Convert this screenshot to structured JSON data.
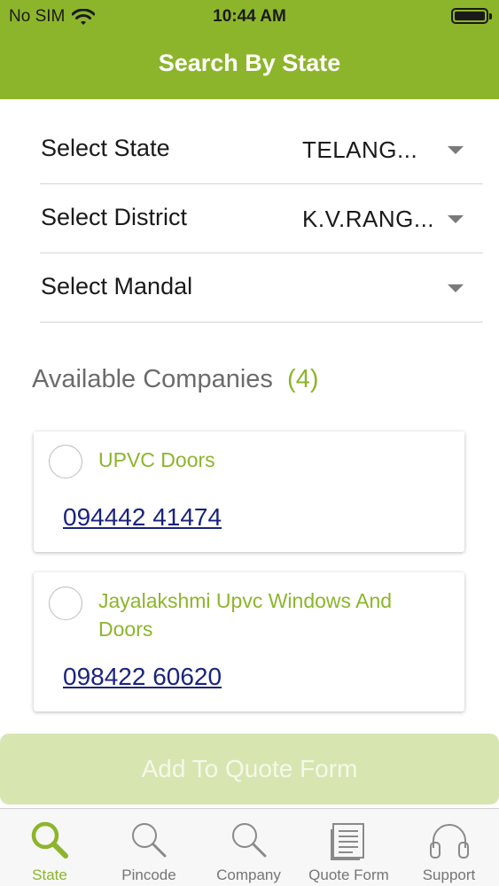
{
  "status_bar": {
    "carrier": "No SIM",
    "time": "10:44 AM",
    "wifi_icon": "wifi-icon",
    "battery_icon": "battery-icon",
    "battery_level": 1.0
  },
  "header": {
    "title": "Search By State"
  },
  "filters": {
    "state": {
      "label": "Select State",
      "value": "TELANG..."
    },
    "district": {
      "label": "Select District",
      "value": "K.V.RANG..."
    },
    "mandal": {
      "label": "Select Mandal",
      "value": ""
    }
  },
  "companies": {
    "title": "Available Companies",
    "count": "(4)",
    "items": [
      {
        "name": "UPVC Doors",
        "phone": "094442 41474",
        "selected": false
      },
      {
        "name": "Jayalakshmi Upvc Windows And Doors",
        "phone": "098422 60620",
        "selected": false
      }
    ]
  },
  "quote_button": {
    "label": "Add To Quote Form"
  },
  "tabs": [
    {
      "label": "State",
      "icon": "search-icon",
      "active": true
    },
    {
      "label": "Pincode",
      "icon": "search-icon",
      "active": false
    },
    {
      "label": "Company",
      "icon": "search-icon",
      "active": false
    },
    {
      "label": "Quote Form",
      "icon": "document-icon",
      "active": false
    },
    {
      "label": "Support",
      "icon": "headphones-icon",
      "active": false
    }
  ],
  "colors": {
    "accent": "#8db52c",
    "link": "#1a237e",
    "button_disabled": "#d7e6b1"
  }
}
